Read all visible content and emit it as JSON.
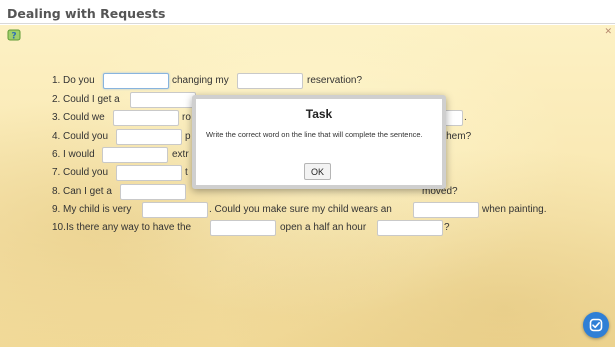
{
  "page": {
    "title": "Dealing with Requests"
  },
  "icons": {
    "help": "help-question-icon",
    "corner": "close-icon",
    "corner_glyph": "✕",
    "check": "check-icon"
  },
  "colors": {
    "paper": "#f8e6ae",
    "accent": "#2f7fd6"
  },
  "exercise": {
    "rows": [
      {
        "number": "1.",
        "segments": [
          "Do you",
          "changing my",
          "reservation?"
        ]
      },
      {
        "number": "2.",
        "segments": [
          "Could I get a"
        ]
      },
      {
        "number": "3.",
        "segments": [
          "Could we",
          "ro",
          "."
        ]
      },
      {
        "number": "4.",
        "segments": [
          "Could you",
          "p",
          "n them?"
        ]
      },
      {
        "number": "6.",
        "segments": [
          "I would",
          "extr"
        ]
      },
      {
        "number": "7.",
        "segments": [
          "Could you",
          "t"
        ]
      },
      {
        "number": "8.",
        "segments": [
          "Can I get a",
          "moved?"
        ]
      },
      {
        "number": "9.",
        "segments": [
          "My child is very",
          ". Could you make sure my child wears an",
          "when painting."
        ]
      },
      {
        "number": "10.",
        "segments": [
          "Is there any way to have the",
          "open a half an hour",
          "?"
        ]
      }
    ]
  },
  "dialog": {
    "title": "Task",
    "message": "Write the correct word on the line that will complete the sentence.",
    "ok_label": "OK"
  }
}
